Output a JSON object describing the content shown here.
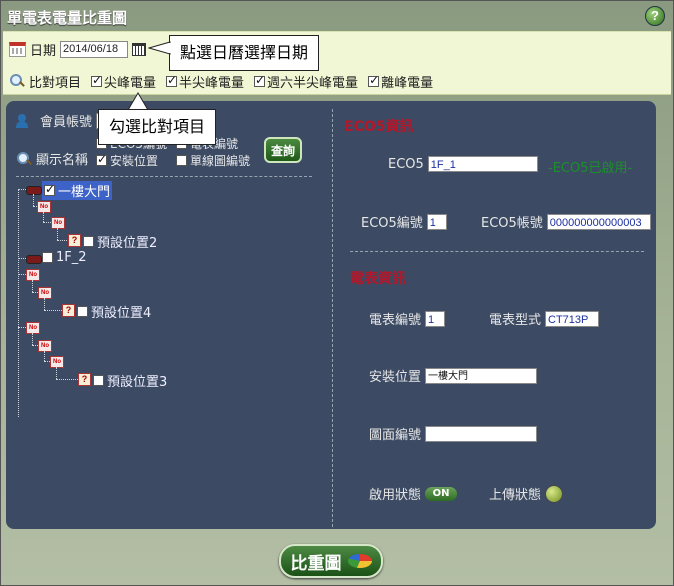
{
  "window": {
    "title": "單電表電量比重圖",
    "help": "?"
  },
  "toolbar": {
    "date_label": "日期",
    "date_value": "2014/06/18",
    "compare_label": "比對項目",
    "compare_items": [
      {
        "label": "尖峰電量",
        "checked": true
      },
      {
        "label": "半尖峰電量",
        "checked": true
      },
      {
        "label": "週六半尖峰電量",
        "checked": true
      },
      {
        "label": "離峰電量",
        "checked": true
      }
    ]
  },
  "callouts": {
    "date_hint": "點選日曆選擇日期",
    "compare_hint": "勾選比對項目"
  },
  "left": {
    "account_label": "會員帳號",
    "account_value": "e",
    "display_name_label": "顯示名稱",
    "query_button": "查詢",
    "options": [
      {
        "label": "ECO5編號",
        "checked": false
      },
      {
        "label": "電表編號",
        "checked": false
      },
      {
        "label": "安裝位置",
        "checked": true
      },
      {
        "label": "單線圖編號",
        "checked": false
      }
    ],
    "tree": {
      "node1": "一樓大門",
      "node1_child": "預設位置2",
      "node2": "1F_2",
      "node3_child": "預設位置4",
      "node4_child": "預設位置3",
      "no_tag": "No",
      "q_tag": "?"
    }
  },
  "eco5": {
    "section_title": "ECO5資訊",
    "eco5_label": "ECO5",
    "eco5_value": "1F_1",
    "eco5_status": "-ECO5已啟用-",
    "id_label": "ECO5編號",
    "id_value": "1",
    "account_label": "ECO5帳號",
    "account_value": "000000000000003"
  },
  "meter": {
    "section_title": "電表資訊",
    "id_label": "電表編號",
    "id_value": "1",
    "model_label": "電表型式",
    "model_value": "CT713P",
    "location_label": "安裝位置",
    "location_value": "一樓大門",
    "diagram_label": "圖面編號",
    "diagram_value": "",
    "enable_label": "啟用狀態",
    "enable_value": "ON",
    "upload_label": "上傳狀態"
  },
  "footer": {
    "ratio_button": "比重圖"
  }
}
